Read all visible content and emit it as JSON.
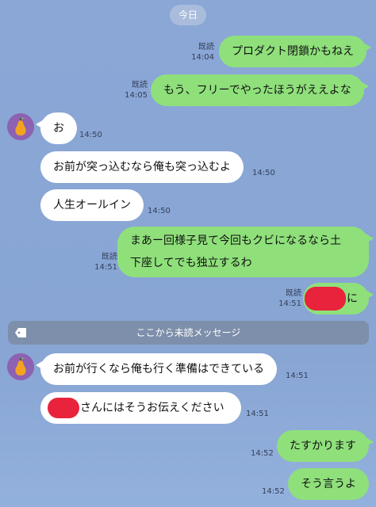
{
  "date_label": "今日",
  "read_label": "既読",
  "unread_label": "ここから未読メッセージ",
  "messages": [
    {
      "side": "me",
      "text": "プロダクト閉鎖かもねえ",
      "time": "14:04",
      "read": true
    },
    {
      "side": "me",
      "text": "もう、フリーでやったほうがええよな",
      "time": "14:05",
      "read": true
    },
    {
      "side": "them",
      "text": "お",
      "time": "14:50"
    },
    {
      "side": "them",
      "text": "お前が突っ込むなら俺も突っ込むよ",
      "time": "14:50"
    },
    {
      "side": "them",
      "text": "人生オールイン",
      "time": "14:50"
    },
    {
      "side": "me",
      "text_line1": "まあー回様子見て今回もクビになるなら土",
      "text_line2": "下座してでも独立するわ",
      "time": "14:51",
      "read": true
    },
    {
      "side": "me",
      "text": "に",
      "time": "14:51",
      "read": true,
      "redacted": true
    },
    {
      "side": "them",
      "text": "お前が行くなら俺も行く準備はできている",
      "time": "14:51"
    },
    {
      "side": "them",
      "text": "さんにはそうお伝えください",
      "time": "14:51",
      "redacted": true
    },
    {
      "side": "me",
      "text": "たすかります",
      "time": "14:52"
    },
    {
      "side": "me",
      "text": "そう言うよ",
      "time": "14:52"
    }
  ]
}
